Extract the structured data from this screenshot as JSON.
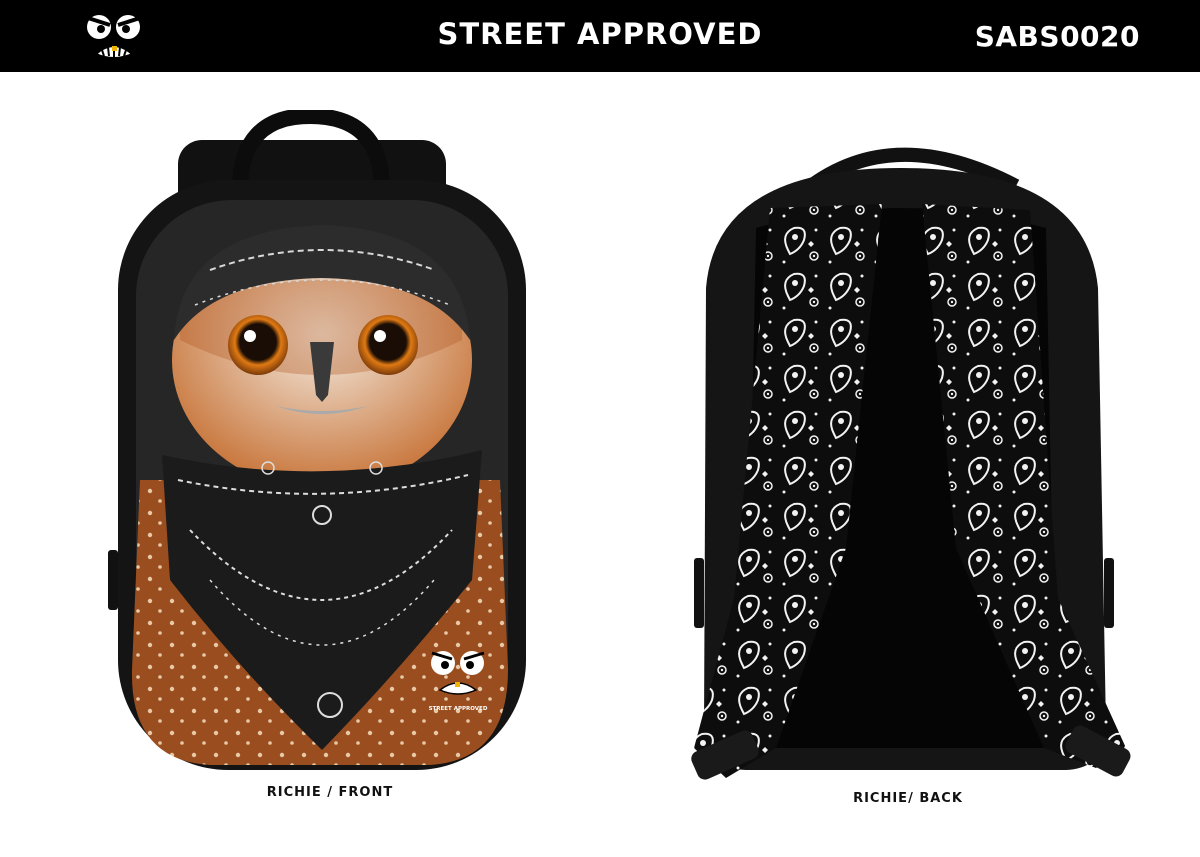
{
  "header": {
    "brand": "STREET APPROVED",
    "sku": "SABS0020",
    "logo_icon": "angry-face-logo-icon"
  },
  "views": [
    {
      "caption": "RICHIE / FRONT"
    },
    {
      "caption": "RICHIE/ BACK"
    }
  ],
  "front": {
    "badge_text": "STREET APPROVED"
  },
  "colors": {
    "header_bg": "#000000",
    "header_text": "#ffffff",
    "owl_feather": "#9a4e1f",
    "bandana": "#1b1b1b"
  }
}
